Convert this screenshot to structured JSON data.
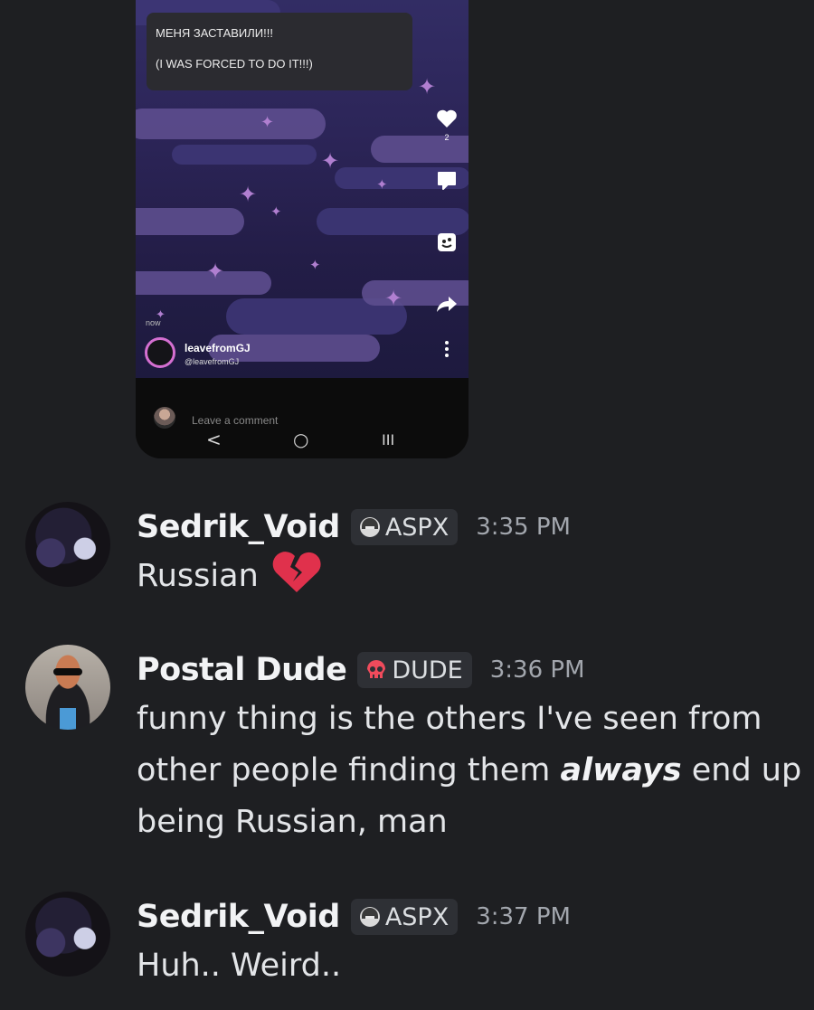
{
  "embedded_screenshot": {
    "caption_lines": [
      "МЕНЯ ЗАСТАВИЛИ!!!",
      "(I WAS FORCED TO DO IT!!!)"
    ],
    "like_count": "2",
    "timestamp": "now",
    "profile_name": "leavefromGJ",
    "profile_handle": "@leavefromGJ",
    "comment_placeholder": "Leave a comment",
    "icons": [
      "heart-icon",
      "comment-icon",
      "remix-icon",
      "share-icon",
      "more-icon",
      "back-nav-icon",
      "home-nav-icon",
      "recents-nav-icon"
    ],
    "nav": {
      "back": "<",
      "home": "○",
      "recents": "III"
    }
  },
  "messages": [
    {
      "author": "Sedrik_Void",
      "tag": "ASPX",
      "tag_icon": "helmet-icon",
      "time": "3:35 PM",
      "text": "Russian",
      "emoji": "broken-heart-icon"
    },
    {
      "author": "Postal Dude",
      "tag": "DUDE",
      "tag_icon": "skull-icon",
      "time": "3:36 PM",
      "lines": {
        "l1": "funny thing is the others I've seen from",
        "l2_pre": "other people finding them ",
        "l2_em": "always",
        "l2_post": " end up",
        "l3": "being Russian, man"
      }
    },
    {
      "author": "Sedrik_Void",
      "tag": "ASPX",
      "tag_icon": "helmet-icon",
      "time": "3:37 PM",
      "text": "Huh.. Weird.."
    }
  ],
  "colors": {
    "background": "#1e1f22",
    "username": "#f2f3f5",
    "timestamp": "#a2a6ad",
    "tag_bg": "#2e3035",
    "broken_heart": "#e0314c",
    "skull": "#f04b5c"
  }
}
